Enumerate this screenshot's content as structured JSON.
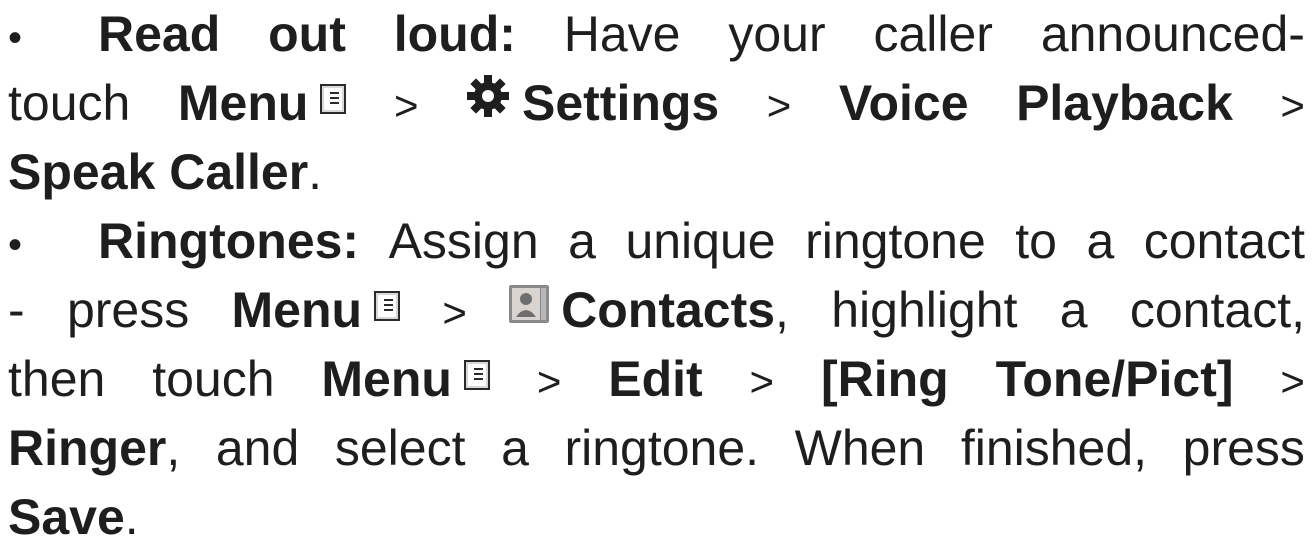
{
  "bullets": [
    {
      "symbol": "•",
      "lines": [
        [
          "Read",
          "out",
          "loud:",
          "Have",
          "your",
          "caller",
          "announced-"
        ],
        [
          "touch",
          "Menu",
          ">",
          "Settings",
          ">",
          "Voice",
          "Playback",
          ">"
        ],
        [
          "Speak Caller",
          "."
        ]
      ]
    },
    {
      "symbol": "•",
      "lines": [
        [
          "Ringtones:",
          "Assign",
          "a",
          "unique",
          "ringtone",
          "to",
          "a",
          "contact"
        ],
        [
          "-",
          "press",
          "Menu",
          ">",
          "Contacts",
          ",",
          "highlight",
          "a",
          "contact,"
        ],
        [
          "then",
          "touch",
          "Menu",
          ">",
          "Edit",
          ">",
          "[Ring",
          "Tone/Pict]",
          ">"
        ],
        [
          "Ringer",
          ",",
          "and",
          "select",
          "a",
          "ringtone.",
          "When",
          "finished,",
          "press"
        ],
        [
          "Save",
          "."
        ]
      ]
    }
  ],
  "icons": {
    "menu": "menu-icon",
    "settings": "gear-icon",
    "contacts": "contacts-icon"
  }
}
